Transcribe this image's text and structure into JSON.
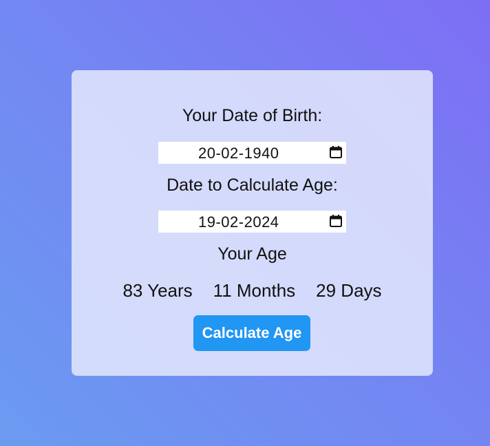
{
  "card": {
    "dob_label": "Your Date of Birth:",
    "dob_value": "20-02-1940",
    "calc_date_label": "Date to Calculate Age:",
    "calc_date_value": "19-02-2024",
    "age_heading": "Your Age",
    "age": {
      "years": "83 Years",
      "months": "11 Months",
      "days": "29 Days"
    },
    "button_label": "Calculate Age"
  },
  "icons": {
    "date_picker": "calendar-icon"
  },
  "colors": {
    "background_gradient": [
      "#7d6ef4",
      "#6b9bf1"
    ],
    "card_background": "#dfe3fb",
    "button": "#2196f3",
    "button_text": "#ffffff"
  }
}
